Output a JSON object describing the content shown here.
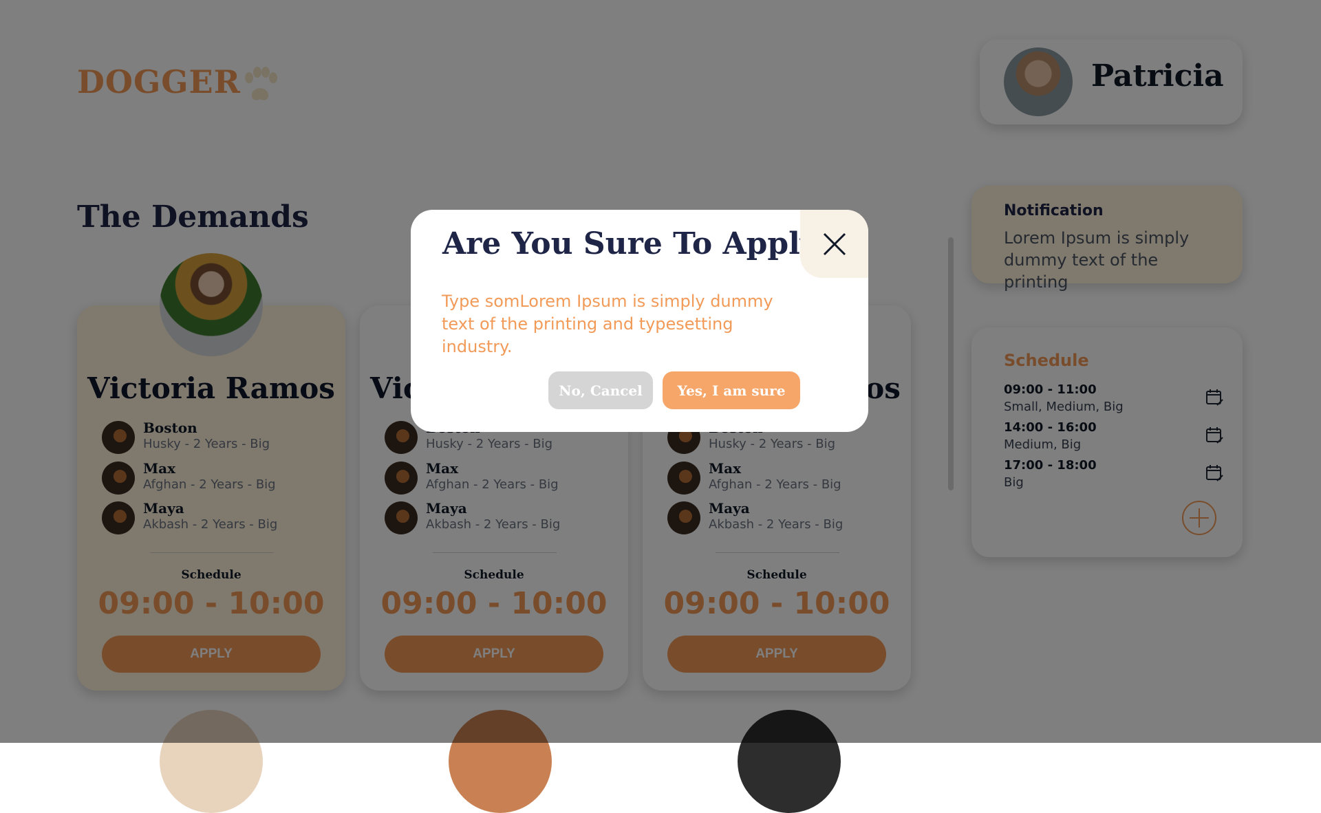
{
  "brand": "DOGGER",
  "user": {
    "name": "Patricia"
  },
  "page": {
    "title": "The Demands"
  },
  "cards": [
    {
      "name": "Victoria Ramos",
      "dogs": [
        {
          "name": "Boston",
          "meta": "Husky - 2 Years - Big"
        },
        {
          "name": "Max",
          "meta": "Afghan - 2 Years - Big"
        },
        {
          "name": "Maya",
          "meta": "Akbash - 2 Years - Big"
        }
      ],
      "schedule_label": "Schedule",
      "time": "09:00 - 10:00",
      "apply_label": "APPLY"
    },
    {
      "name": "Victoria Ramos",
      "dogs": [
        {
          "name": "Boston",
          "meta": "Husky - 2 Years - Big"
        },
        {
          "name": "Max",
          "meta": "Afghan - 2 Years - Big"
        },
        {
          "name": "Maya",
          "meta": "Akbash - 2 Years - Big"
        }
      ],
      "schedule_label": "Schedule",
      "time": "09:00 - 10:00",
      "apply_label": "APPLY"
    },
    {
      "name": "Victoria Ramos",
      "dogs": [
        {
          "name": "Boston",
          "meta": "Husky - 2 Years - Big"
        },
        {
          "name": "Max",
          "meta": "Afghan - 2 Years - Big"
        },
        {
          "name": "Maya",
          "meta": "Akbash - 2 Years - Big"
        }
      ],
      "schedule_label": "Schedule",
      "time": "09:00 - 10:00",
      "apply_label": "APPLY"
    }
  ],
  "notification": {
    "title": "Notification",
    "text": "Lorem Ipsum is simply dummy text of the printing"
  },
  "schedule": {
    "title": "Schedule",
    "items": [
      {
        "time": "09:00 - 11:00",
        "desc": "Small, Medium, Big"
      },
      {
        "time": "14:00 - 16:00",
        "desc": "Medium, Big"
      },
      {
        "time": "17:00 - 18:00",
        "desc": "Big"
      }
    ]
  },
  "modal": {
    "title": "Are You Sure To Apply?",
    "body": "Type somLorem Ipsum is simply dummy text of the printing and typesetting industry.",
    "cancel_label": "No, Cancel",
    "confirm_label": "Yes, I am sure"
  },
  "colors": {
    "accent": "#f29a58",
    "navy": "#1f2547",
    "featured_card": "#fff2dc",
    "overlay": "#00000080"
  },
  "icons": {
    "paw": "paw-icon",
    "calendar": "calendar-edit-icon",
    "close": "close-icon",
    "add": "plus-icon"
  }
}
